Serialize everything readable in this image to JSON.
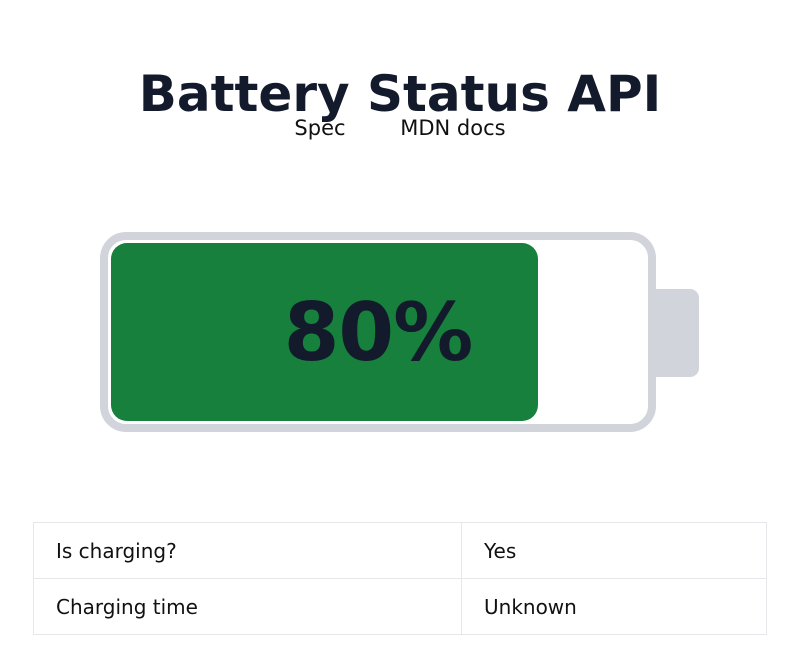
{
  "page": {
    "title": "Battery Status API"
  },
  "nav": {
    "links": [
      {
        "label": "Spec"
      },
      {
        "label": "MDN docs"
      }
    ]
  },
  "battery": {
    "level_percent": 80,
    "level_text": "80%",
    "fill_color": "#16803c",
    "shell_color": "#d1d5db"
  },
  "status_table": {
    "rows": [
      {
        "label": "Is charging?",
        "value": "Yes"
      },
      {
        "label": "Charging time",
        "value": "Unknown"
      }
    ]
  }
}
